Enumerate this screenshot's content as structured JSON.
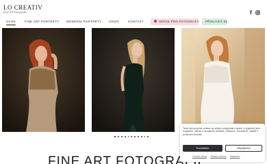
{
  "brand": {
    "name": "LO CREATIV",
    "tagline": "Fine Art Fotografie"
  },
  "header": {
    "social": [
      {
        "name": "facebook",
        "icon": "facebook-icon",
        "glyph": "f"
      },
      {
        "name": "instagram",
        "icon": "instagram-icon"
      }
    ]
  },
  "nav": {
    "items": [
      {
        "label": "ÚVOD",
        "active": true
      },
      {
        "label": "FINE ART PORTRÉTY",
        "active": false
      },
      {
        "label": "MODERNÍ PORTRÉTY",
        "active": false
      },
      {
        "label": "CENÍK",
        "active": false
      },
      {
        "label": "KONTAKT",
        "active": false
      }
    ],
    "shoot_button": "SERCE PRO FOTOGRAFY",
    "login_button": "PŘIHLÁSIT SE"
  },
  "slider": {
    "photos": [
      {
        "name": "portrait-redhead-gold-dress"
      },
      {
        "name": "portrait-blonde-black-dress"
      },
      {
        "name": "portrait-redhead-white-dress"
      }
    ],
    "dot_count": 11,
    "active_dot": 0
  },
  "main": {
    "heading": "FINE ART FOTOGRAFIE"
  },
  "cookie": {
    "text": "Tento web používá cookies za účelem poskytování služeb, k vylepšení jeho fungování, měření a usnadnění přehledu. Kliknutím „Souhlasím“ udělíte k používání souhlas.",
    "accept": "Souhlasím",
    "reject": "Nepřijmout",
    "links": [
      "Cookies policy",
      "Zásady ochrany",
      "Nastavení"
    ]
  },
  "colors": {
    "pink_pill": "#f6dde4",
    "green_pill": "#d6eedd",
    "accept_bg": "#2b2d31"
  }
}
